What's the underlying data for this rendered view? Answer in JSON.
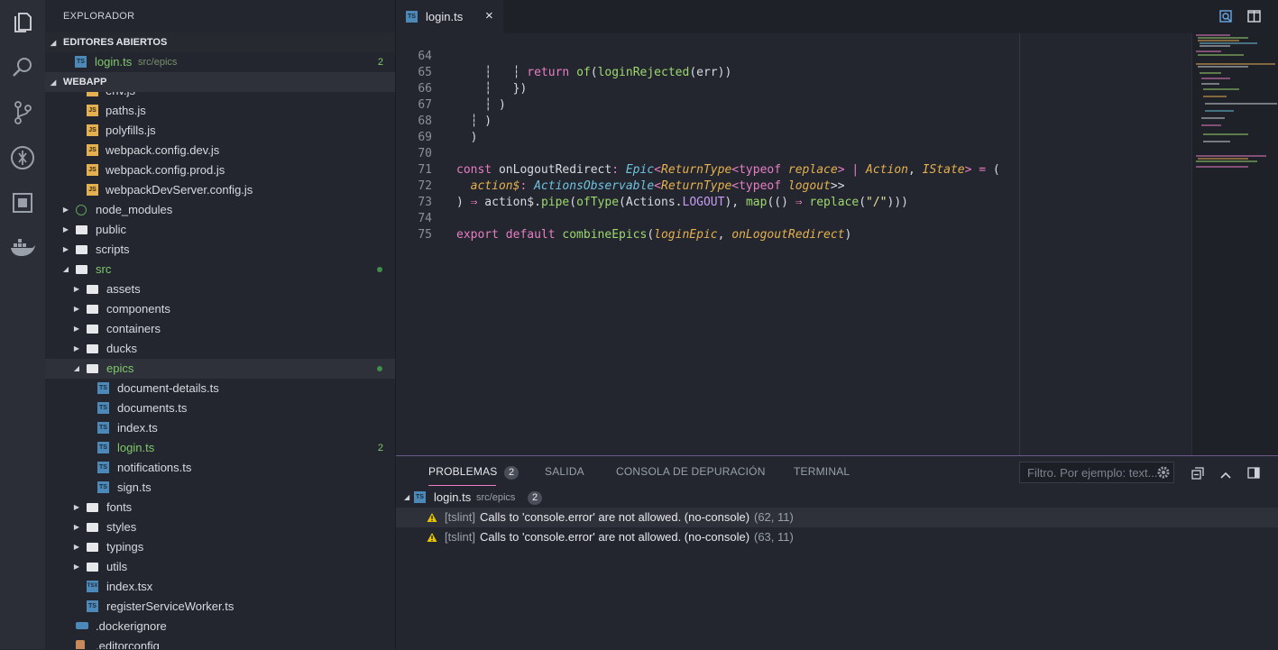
{
  "explorer": {
    "title": "EXPLORADOR",
    "open_editors": {
      "heading": "EDITORES ABIERTOS",
      "items": [
        {
          "name": "login.ts",
          "path": "src/epics",
          "count": "2"
        }
      ]
    },
    "workspace": {
      "heading": "WEBAPP",
      "tree": {
        "envjs": "env.js",
        "pathsjs": "paths.js",
        "polyfills": "polyfills.js",
        "wp_dev": "webpack.config.dev.js",
        "wp_prod": "webpack.config.prod.js",
        "wp_server": "webpackDevServer.config.js",
        "node_modules": "node_modules",
        "public": "public",
        "scripts": "scripts",
        "src": "src",
        "assets": "assets",
        "components": "components",
        "containers": "containers",
        "ducks": "ducks",
        "epics": "epics",
        "document_details": "document-details.ts",
        "documents": "documents.ts",
        "index_ts": "index.ts",
        "login": "login.ts",
        "login_count": "2",
        "notifications": "notifications.ts",
        "sign": "sign.ts",
        "fonts": "fonts",
        "styles": "styles",
        "typings": "typings",
        "utils": "utils",
        "index_tsx": "index.tsx",
        "register_sw": "registerServiceWorker.ts",
        "dockerignore": ".dockerignore",
        "editorconfig": ".editorconfig"
      }
    }
  },
  "editor": {
    "tab": {
      "label": "login.ts",
      "icon_text": "TS"
    },
    "lines": [
      {
        "n": "64"
      },
      {
        "n": "65"
      },
      {
        "n": "66"
      },
      {
        "n": "67"
      },
      {
        "n": "68"
      },
      {
        "n": "69"
      },
      {
        "n": "70"
      },
      {
        "n": "71"
      },
      {
        "n": "72"
      },
      {
        "n": "73"
      },
      {
        "n": "74"
      },
      {
        "n": "75"
      }
    ]
  },
  "panel": {
    "tabs": {
      "problems": "PROBLEMAS",
      "problems_count": "2",
      "output": "SALIDA",
      "debug": "CONSOLA DE DEPURACIÓN",
      "terminal": "TERMINAL"
    },
    "filter_placeholder": "Filtro. Por ejemplo: text...",
    "group": {
      "file": "login.ts",
      "path": "src/epics",
      "count": "2"
    },
    "problems": [
      {
        "source": "[tslint]",
        "message": "Calls to 'console.error' are not allowed. (no-console)",
        "pos": "(62, 11)"
      },
      {
        "source": "[tslint]",
        "message": "Calls to 'console.error' are not allowed. (no-console)",
        "pos": "(63, 11)"
      }
    ]
  },
  "colors": {
    "accent_green": "#7fc96b",
    "keyword_pink": "#e87dc4",
    "type_orange": "#e5b04f",
    "func_green": "#9dd86e",
    "warning_yellow": "#e6c400",
    "panel_border": "#6e5a8a"
  },
  "icons": [
    "files-icon",
    "search-icon",
    "source-control-icon",
    "debug-icon",
    "extensions-icon",
    "docker-icon",
    "split-editor-icon",
    "compare-icon",
    "gear-icon",
    "collapse-all-icon",
    "chevron-up-icon",
    "layout-panel-icon",
    "warning-icon",
    "close-icon"
  ]
}
